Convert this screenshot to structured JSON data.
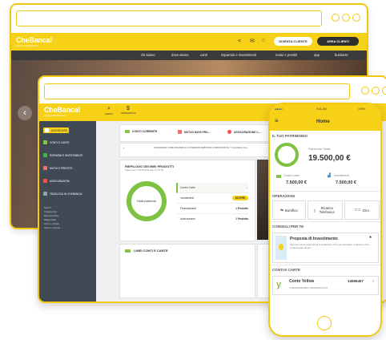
{
  "brand": {
    "name": "CheBanca!",
    "tagline": "Gruppo Mediobanca",
    "accent": "#f7d117",
    "dark": "#3b3b3b"
  },
  "back_site": {
    "header_buttons": {
      "become_client": "DIVENTA CLIENTE",
      "client_area": "AREA CLIENTI"
    },
    "nav": [
      "chi siamo",
      "dove siamo",
      "canti",
      "risparmio e investimenti",
      "mutui e prestiti",
      "app",
      "business"
    ]
  },
  "dashboard": {
    "top_icons": [
      "CERCA",
      "OPERAZIONI"
    ],
    "sidebar": [
      "DASHBOARD",
      "CONTI E CARTE",
      "RISPARMI E INVESTIMENTI",
      "MUTUI E PRESTITI",
      "ASSICURAZIONI",
      "TRASLOCA IN CHEBANCA!"
    ],
    "sidebar_small": [
      "Servizi",
      "Trasparenza",
      "Bancomat Pay",
      "Mappe filiali",
      "Aiuto e contatti",
      "Tasse e imposte"
    ],
    "shortcuts": [
      "CONTO CORRENTE",
      "MUTUO BAYA PRO...",
      "ASSICURAZIONE C..."
    ],
    "alert": "SCEGLIERE COME PAGARE GLI INTERESSI DEBITORI E IMPORTANTE. Ti ricordiamo che...",
    "riepilogo": {
      "title": "RIEPILOGO DEI MIEI PRODOTTI",
      "subtitle": "Aggiornato il 30/04/2019 alle ore 15:00",
      "donut_label": "Totale patrimonio",
      "rows": [
        {
          "label": "Conti e Carte",
          "value": ""
        },
        {
          "label": "Investimenti",
          "value": "SCOPRI"
        },
        {
          "label": "Finanziamenti",
          "value": "1 Prodotto"
        },
        {
          "label": "Assicurazioni",
          "value": "1 Prodotto"
        }
      ]
    },
    "conti_title": "I MIEI CONTI E CARTE"
  },
  "phone": {
    "status_time": "9:41 AM",
    "status_battery": "100%",
    "title": "Home",
    "patrimonio_title": "IL TUO PATRIMONIO",
    "total_label": "Patrimonio Totale",
    "total_value": "19.500,00 €",
    "conti_label": "Conti e carte",
    "conti_value": "7.500,00 €",
    "invest_label": "Investimenti",
    "invest_value": "7.500,00 €",
    "operazioni_title": "OPERAZIONI",
    "operazioni": [
      "Bonifico",
      "Ricarica Telefonica",
      "Giro"
    ],
    "consigli_title": "CONSIGLI PER TE",
    "proposta_title": "Proposta di Investimento",
    "proposta_text": "Hai una nuova proposta di investimento che puoi accettare o rifiutare entro il pomeriggio da ieri.",
    "carte_title": "CONTI E CARTE",
    "conto_name": "Conto Yellow",
    "conto_number": "14566457",
    "conto_iban": "IT18W0324850807 0000000001734"
  }
}
